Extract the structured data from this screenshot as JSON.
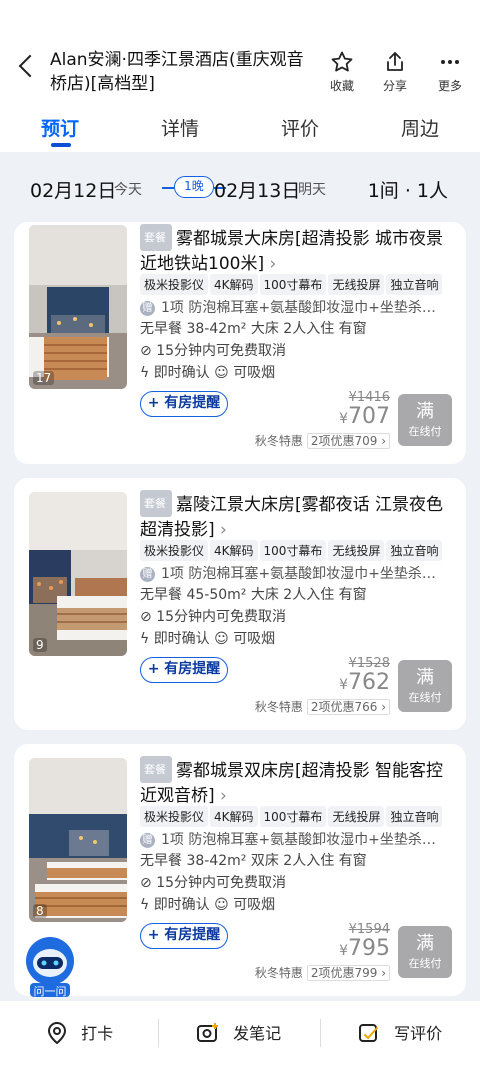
{
  "header": {
    "title": "Alan安澜·四季江景酒店(重庆观音桥店)[高档型]",
    "favorite_label": "收藏",
    "share_label": "分享",
    "more_label": "更多"
  },
  "tabs": [
    {
      "label": "预订"
    },
    {
      "label": "详情"
    },
    {
      "label": "评价"
    },
    {
      "label": "周边"
    }
  ],
  "date_bar": {
    "checkin_date": "02月12日",
    "checkin_day": "今天",
    "nights": "1晚",
    "checkout_date": "02月13日",
    "checkout_day": "明天",
    "rooms_guests": "1间 · 1人"
  },
  "rooms": [
    {
      "package_badge": "套餐",
      "name": "雾都城景大床房[超清投影 城市夜景 近地铁站100米]",
      "photo_count": "17",
      "tags": [
        "极米投影仪",
        "4K解码",
        "100寸幕布",
        "无线投屏",
        "独立音响"
      ],
      "package_count": "1项",
      "package_desc": "防泡棉耳塞+氨基酸卸妆湿巾+坐垫杀…",
      "info": "无早餐  38-42m²  大床  2人入住  有窗",
      "cancel_policy": "15分钟内可免费取消",
      "confirm": "即时确认",
      "smoking": "可吸烟",
      "remind_label": "有房提醒",
      "original_price": "¥1416",
      "currency": "¥",
      "price": "707",
      "full_label": "满",
      "full_sub": "在线付",
      "promo_label": "秋冬特惠",
      "promo_discount": "2项优惠709"
    },
    {
      "package_badge": "套餐",
      "name": "嘉陵江景大床房[雾都夜话 江景夜色 超清投影]",
      "photo_count": "9",
      "tags": [
        "极米投影仪",
        "4K解码",
        "100寸幕布",
        "无线投屏",
        "独立音响"
      ],
      "package_count": "1项",
      "package_desc": "防泡棉耳塞+氨基酸卸妆湿巾+坐垫杀…",
      "info": "无早餐  45-50m²  大床  2人入住  有窗",
      "cancel_policy": "15分钟内可免费取消",
      "confirm": "即时确认",
      "smoking": "可吸烟",
      "remind_label": "有房提醒",
      "original_price": "¥1528",
      "currency": "¥",
      "price": "762",
      "full_label": "满",
      "full_sub": "在线付",
      "promo_label": "秋冬特惠",
      "promo_discount": "2项优惠766"
    },
    {
      "package_badge": "套餐",
      "name": "雾都城景双床房[超清投影 智能客控 近观音桥]",
      "photo_count": "8",
      "tags": [
        "极米投影仪",
        "4K解码",
        "100寸幕布",
        "无线投屏",
        "独立音响"
      ],
      "package_count": "1项",
      "package_desc": "防泡棉耳塞+氨基酸卸妆湿巾+坐垫杀…",
      "info": "无早餐  38-42m²  双床  2人入住  有窗",
      "cancel_policy": "15分钟内可免费取消",
      "confirm": "即时确认",
      "smoking": "可吸烟",
      "remind_label": "有房提醒",
      "original_price": "¥1594",
      "currency": "¥",
      "price": "795",
      "full_label": "满",
      "full_sub": "在线付",
      "promo_label": "秋冬特惠",
      "promo_discount": "2项优惠799"
    }
  ],
  "assistant": {
    "label": "问一问"
  },
  "bottom_bar": {
    "checkin_label": "打卡",
    "note_label": "发笔记",
    "review_label": "写评价"
  },
  "colors": {
    "accent": "#0066ff",
    "sold_out": "#a9a9ab"
  }
}
